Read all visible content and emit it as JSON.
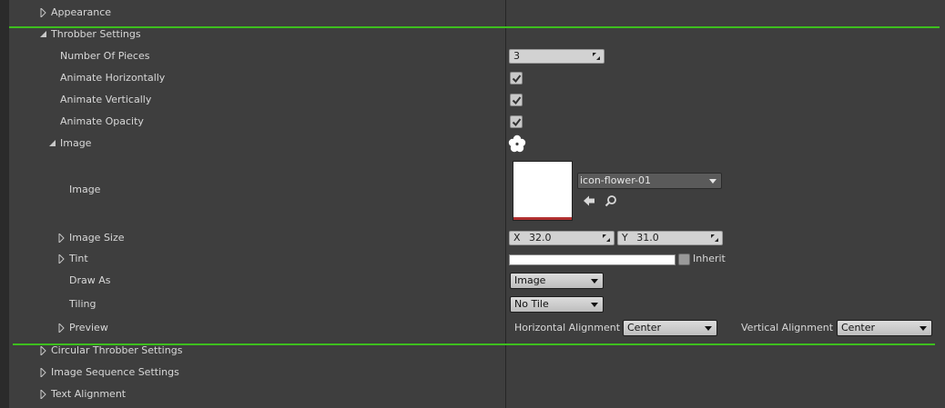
{
  "rows": {
    "appearance": "Appearance",
    "throbber_settings": "Throbber Settings",
    "number_of_pieces": "Number Of Pieces",
    "animate_horizontally": "Animate Horizontally",
    "animate_vertically": "Animate Vertically",
    "animate_opacity": "Animate Opacity",
    "image_group": "Image",
    "image": "Image",
    "image_size": "Image Size",
    "tint": "Tint",
    "draw_as": "Draw As",
    "tiling": "Tiling",
    "preview": "Preview",
    "circular_throbber_settings": "Circular Throbber Settings",
    "image_sequence_settings": "Image Sequence Settings",
    "text_alignment": "Text Alignment"
  },
  "values": {
    "number_of_pieces": "3",
    "animate_horizontally_checked": true,
    "animate_vertically_checked": true,
    "animate_opacity_checked": true,
    "asset_name": "icon-flower-01",
    "image_size_x_label": "X",
    "image_size_x": "32.0",
    "image_size_y_label": "Y",
    "image_size_y": "31.0",
    "tint_inherit_label": "Inherit",
    "draw_as": "Image",
    "tiling": "No Tile",
    "horizontal_alignment_label": "Horizontal Alignment",
    "horizontal_alignment": "Center",
    "vertical_alignment_label": "Vertical Alignment",
    "vertical_alignment": "Center"
  },
  "icons": {
    "expanded": "triangle-down-right-icon",
    "collapsed": "triangle-right-icon",
    "image_preview": "flower-icon",
    "use_selected": "arrow-left-icon",
    "browse": "search-icon"
  },
  "colors": {
    "panel_bg": "#3e3e3e",
    "highlight_line": "#3dbf1e",
    "text": "#d8d8d8"
  }
}
